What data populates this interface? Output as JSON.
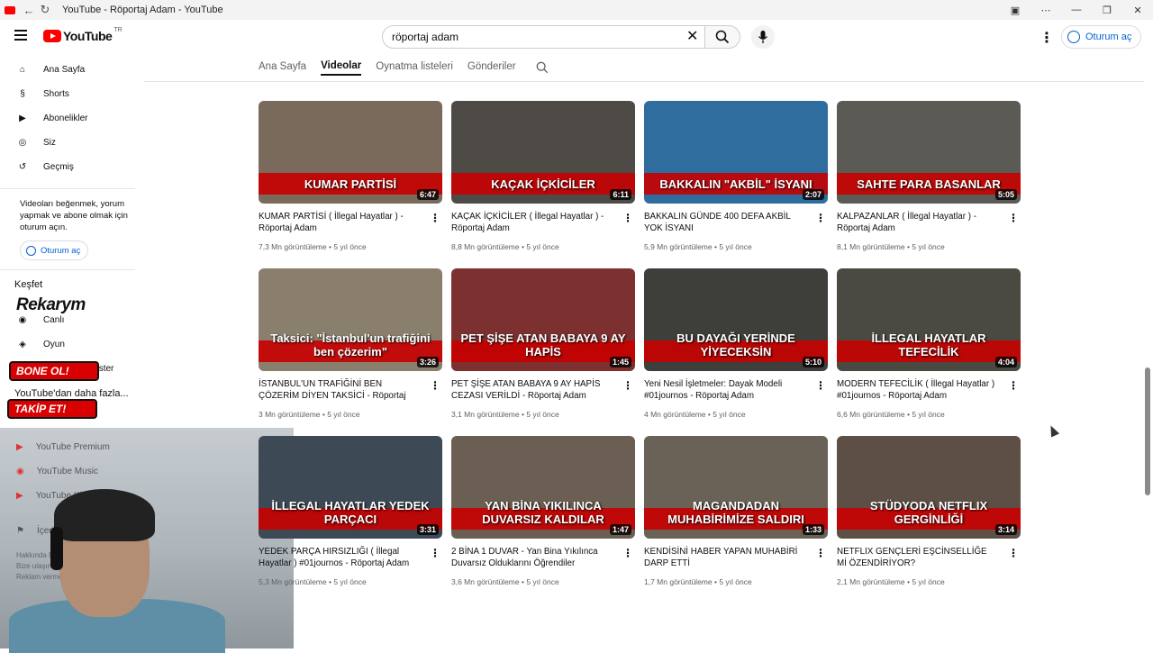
{
  "window": {
    "title": "YouTube - Röportaj Adam - YouTube"
  },
  "masthead": {
    "logo_text": "YouTube",
    "country": "TR",
    "search_value": "röportaj adam",
    "signin_label": "Oturum aç"
  },
  "sidebar": {
    "items": [
      {
        "label": "Ana Sayfa",
        "icon": "home-icon"
      },
      {
        "label": "Shorts",
        "icon": "shorts-icon"
      },
      {
        "label": "Abonelikler",
        "icon": "subscriptions-icon"
      },
      {
        "label": "Siz",
        "icon": "you-icon"
      },
      {
        "label": "Geçmiş",
        "icon": "history-icon"
      }
    ],
    "note": "Videoları beğenmek, yorum yapmak ve abone olmak için oturum açın.",
    "signin_label": "Oturum aç",
    "explore_heading": "Keşfet",
    "explore_items": [
      "Canlı",
      "Oyun",
      "Daha fazla göster"
    ],
    "more_heading": "YouTube'dan daha fazla...",
    "more_items": [
      "YouTube Premium",
      "YouTube Music",
      "YouTube Kids"
    ],
    "report_item": "İçerik",
    "footer_lines": [
      "Hakkında  B",
      "Bize ulaşın  İç",
      "Reklam verme"
    ]
  },
  "overlays": {
    "brand": "Rekarym",
    "follow_label": "BONE OL!",
    "subscribe_label": "TAKİP ET!"
  },
  "tabs": [
    "Ana Sayfa",
    "Videolar",
    "Oynatma listeleri",
    "Gönderiler"
  ],
  "active_tab": "Videolar",
  "videos": [
    {
      "title": "KUMAR PARTİSİ ( İllegal Hayatlar ) - Röportaj Adam",
      "views": "7,3 Mn görüntüleme",
      "age": "5 yıl önce",
      "duration": "6:47",
      "caption": "KUMAR PARTİSİ",
      "color": "#7a6a5c"
    },
    {
      "title": "KAÇAK İÇKİCİLER ( İllegal Hayatlar ) - Röportaj Adam",
      "views": "8,8 Mn görüntüleme",
      "age": "5 yıl önce",
      "duration": "6:11",
      "caption": "KAÇAK İÇKİCİLER",
      "color": "#4e4a45"
    },
    {
      "title": "BAKKALIN GÜNDE 400 DEFA AKBİL YOK İSYANI",
      "views": "5,9 Mn görüntüleme",
      "age": "5 yıl önce",
      "duration": "2:07",
      "caption": "BAKKALIN \"AKBİL\" İSYANI",
      "color": "#2f6d9e"
    },
    {
      "title": "KALPAZANLAR ( İllegal Hayatlar ) - Röportaj Adam",
      "views": "8,1 Mn görüntüleme",
      "age": "5 yıl önce",
      "duration": "5:05",
      "caption": "SAHTE PARA BASANLAR",
      "color": "#5c5a55"
    },
    {
      "title": "İSTANBUL'UN TRAFİĞİNİ BEN ÇÖZERİM DİYEN TAKSİCİ - Röportaj Adam",
      "views": "3 Mn görüntüleme",
      "age": "5 yıl önce",
      "duration": "3:26",
      "caption": "Taksici: \"İstanbul'un trafiğini ben çözerim\"",
      "color": "#8a7f6d"
    },
    {
      "title": "PET ŞİŞE ATAN BABAYA 9 AY HAPİS CEZASI VERİLDİ - Röportaj Adam",
      "views": "3,1 Mn görüntüleme",
      "age": "5 yıl önce",
      "duration": "1:45",
      "caption": "PET ŞİŞE ATAN BABAYA 9 AY HAPİS",
      "color": "#7c3030"
    },
    {
      "title": "Yeni Nesil İşletmeler: Dayak Modeli #01journos - Röportaj Adam",
      "views": "4 Mn görüntüleme",
      "age": "5 yıl önce",
      "duration": "5:10",
      "caption": "BU DAYAĞI YERİNDE YİYECEKSİN",
      "color": "#3e3e3a"
    },
    {
      "title": "MODERN TEFECİLİK ( İllegal Hayatlar ) #01journos - Röportaj Adam",
      "views": "6,6 Mn görüntüleme",
      "age": "5 yıl önce",
      "duration": "4:04",
      "caption": "İLLEGAL HAYATLAR TEFECİLİK",
      "color": "#4a4a42"
    },
    {
      "title": "YEDEK PARÇA HIRSIZLIĞI ( İllegal Hayatlar ) #01journos - Röportaj Adam",
      "views": "5,3 Mn görüntüleme",
      "age": "5 yıl önce",
      "duration": "3:31",
      "caption": "İLLEGAL HAYATLAR YEDEK PARÇACI",
      "color": "#3d4a55"
    },
    {
      "title": "2 BİNA 1 DUVAR - Yan Bina Yıkılınca Duvarsız Olduklarını Öğrendiler",
      "views": "3,6 Mn görüntüleme",
      "age": "5 yıl önce",
      "duration": "1:47",
      "caption": "YAN BİNA YIKILINCA DUVARSIZ KALDILAR",
      "color": "#6b5e52"
    },
    {
      "title": "KENDİSİNİ HABER YAPAN MUHABİRİ DARP ETTİ",
      "views": "1,7 Mn görüntüleme",
      "age": "5 yıl önce",
      "duration": "1:33",
      "caption": "MAGANDADAN MUHABİRİMİZE SALDIRI",
      "color": "#6a6256"
    },
    {
      "title": "NETFLIX GENÇLERİ EŞCİNSELLİĞE Mİ ÖZENDİRİYOR?",
      "views": "2,1 Mn görüntüleme",
      "age": "5 yıl önce",
      "duration": "3:14",
      "caption": "STÜDYODA NETFLIX GERGİNLİĞİ",
      "color": "#5d4f45"
    }
  ],
  "colors": {
    "brand_red": "#ff0000",
    "link_blue": "#065fd4",
    "meta_gray": "#606060"
  }
}
